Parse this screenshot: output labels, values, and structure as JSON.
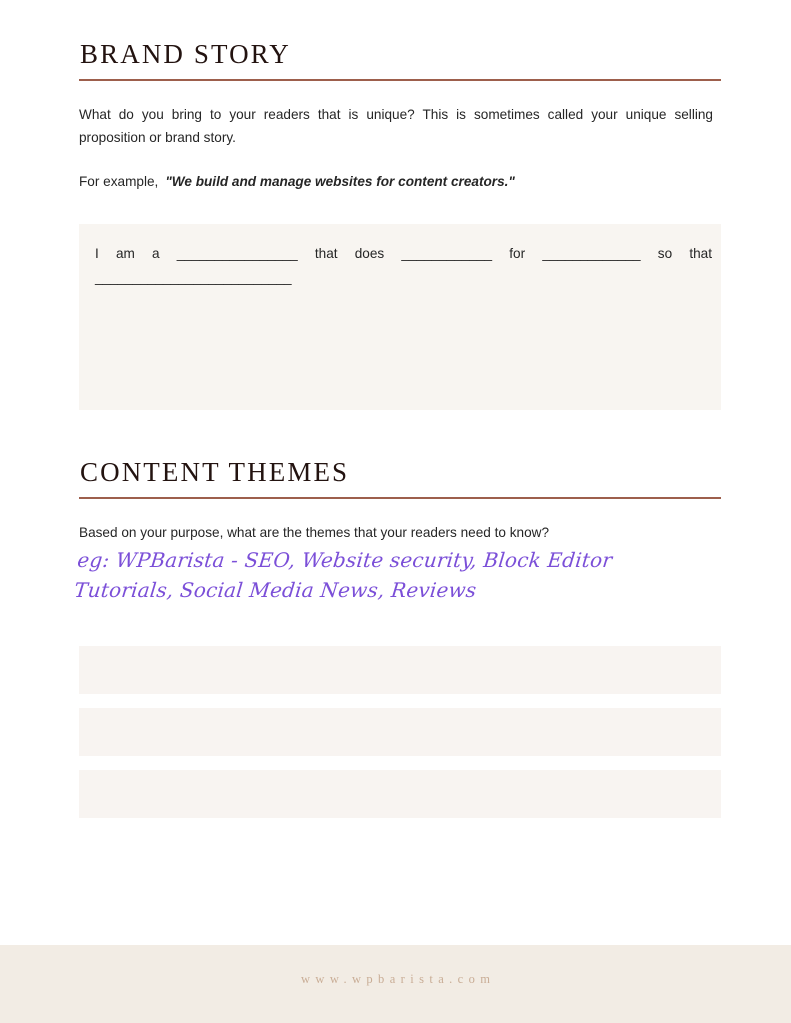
{
  "document": {
    "footer_url": "www.wpbarista.com"
  },
  "brand_story": {
    "title": "BRAND STORY",
    "intro": "What do you bring to your readers that is unique? This is sometimes called your unique selling proposition or brand story.",
    "example_label": "For example,",
    "example_quote": "\"We build and manage websites for content creators.\"",
    "fill_in_prompt": "I am a ________________ that does ____________ for _____________ so that __________________________"
  },
  "content_themes": {
    "title": "CONTENT THEMES",
    "prompt": "Based on your purpose, what are the themes that your readers need to know?",
    "example_handwritten": "eg: WPBarista - SEO, Website security, Block Editor Tutorials, Social Media News, Reviews",
    "answer_boxes": [
      "",
      "",
      ""
    ]
  },
  "colors": {
    "rule": "#9d5f4c",
    "heading": "#231310",
    "body_text": "#262626",
    "handwriting": "#7b4fd8",
    "box_fill": "#f8f5f1",
    "footer_band": "#f2ece4",
    "footer_text": "#c9ad96"
  }
}
